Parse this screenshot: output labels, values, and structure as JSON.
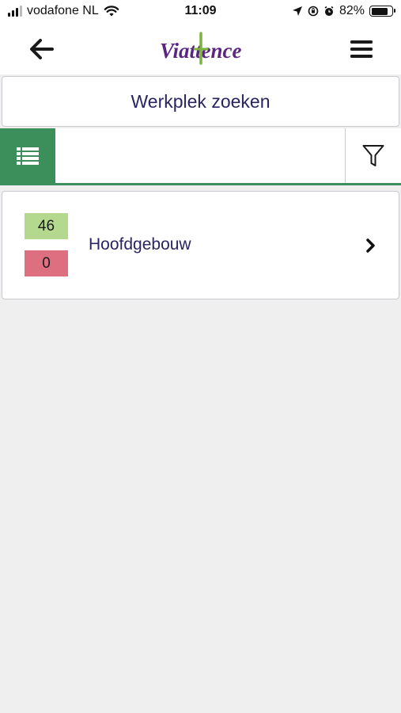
{
  "status_bar": {
    "carrier": "vodafone NL",
    "time": "11:09",
    "battery_percent": "82%",
    "battery_level": 0.82
  },
  "header": {
    "logo_text": "Viattence",
    "back_icon": "arrow-left-icon",
    "menu_icon": "hamburger-menu-icon"
  },
  "search": {
    "title": "Werkplek zoeken"
  },
  "toolbar": {
    "list_icon": "list-view-icon",
    "filter_value": "",
    "filter_icon": "funnel-filter-icon"
  },
  "locations": [
    {
      "name": "Hoofdgebouw",
      "free_count": "46",
      "busy_count": "0"
    }
  ],
  "colors": {
    "primary_green": "#3c8e5a",
    "free_badge": "#b4d98e",
    "busy_badge": "#de6f80",
    "text_navy": "#2a2460",
    "background": "#efeff0",
    "logo_purple": "#5a2680",
    "logo_green": "#7cb342"
  }
}
